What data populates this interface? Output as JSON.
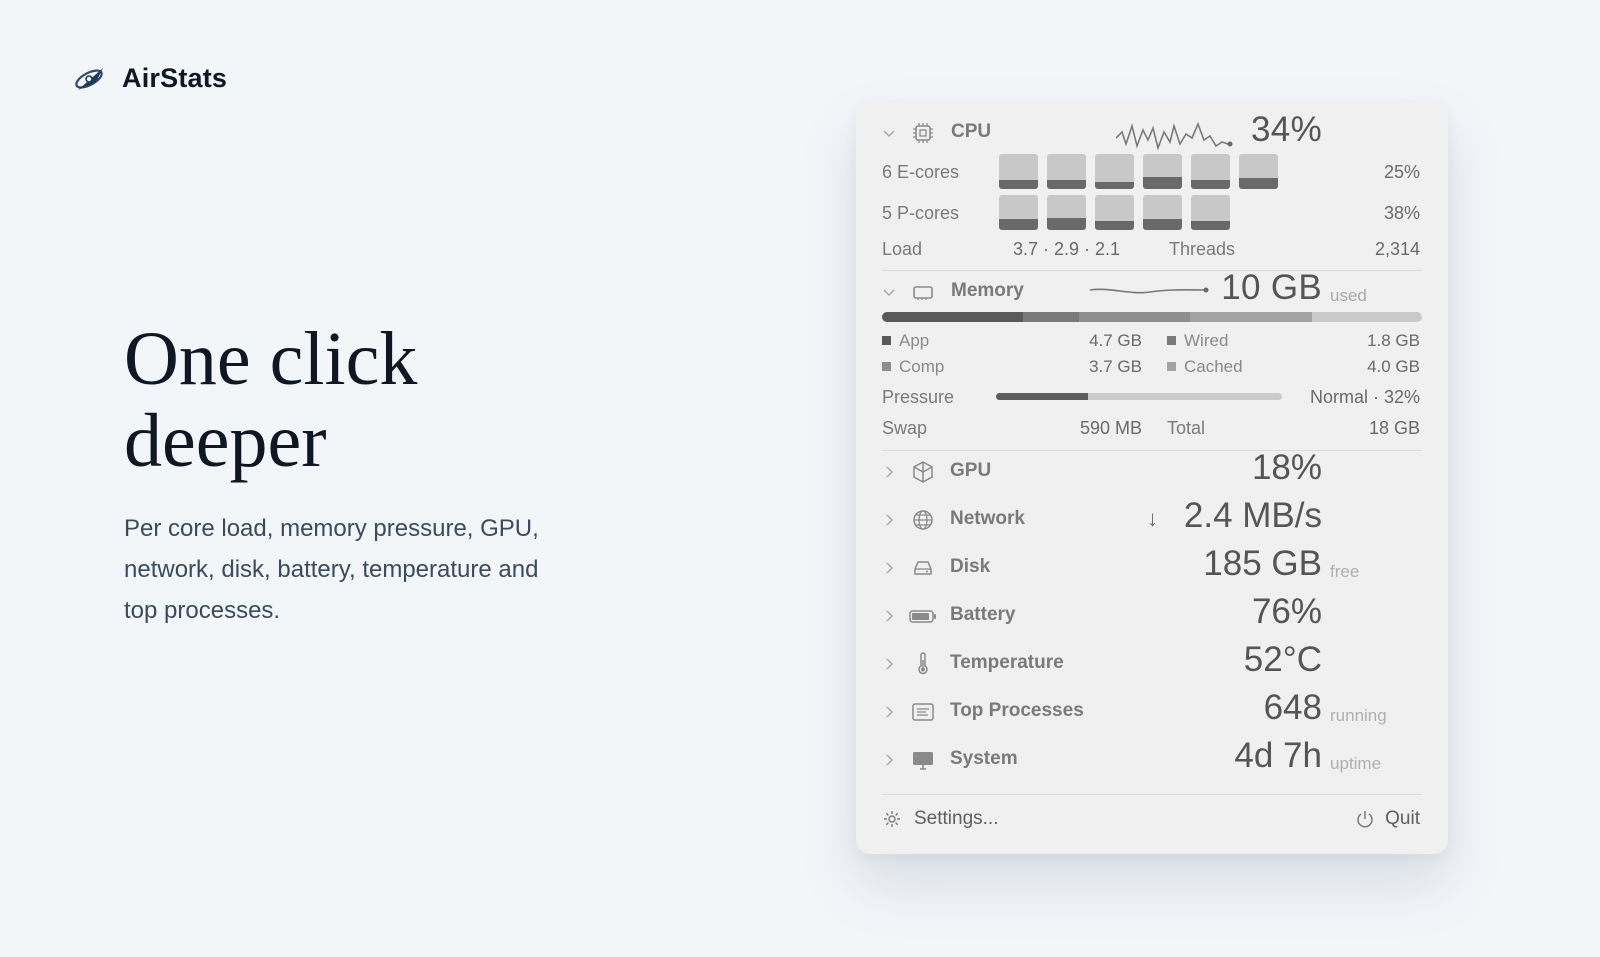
{
  "brand": {
    "name": "AirStats"
  },
  "hero": {
    "headline_line1": "One click",
    "headline_line2": "deeper",
    "subtitle": "Per core load, memory pressure, GPU, network, disk, battery, temperature and top processes."
  },
  "panel": {
    "cpu": {
      "label": "CPU",
      "value": "34%",
      "ecores_label": "6 E-cores",
      "ecores_pct": "25%",
      "ecore_loads": [
        0.25,
        0.25,
        0.2,
        0.35,
        0.25,
        0.3
      ],
      "pcores_label": "5 P-cores",
      "pcores_pct": "38%",
      "pcore_loads": [
        0.3,
        0.35,
        0.25,
        0.3,
        0.25
      ],
      "load_label": "Load",
      "load_value": "3.7 · 2.9 · 2.1",
      "threads_label": "Threads",
      "threads_value": "2,314"
    },
    "memory": {
      "label": "Memory",
      "value": "10 GB",
      "unit": "used",
      "app_label": "App",
      "app_value": "4.7 GB",
      "wired_label": "Wired",
      "wired_value": "1.8 GB",
      "comp_label": "Comp",
      "comp_value": "3.7 GB",
      "cached_label": "Cached",
      "cached_value": "4.0 GB",
      "pressure_label": "Pressure",
      "pressure_value": "Normal · 32%",
      "pressure_level": 0.32,
      "swap_label": "Swap",
      "swap_value": "590 MB",
      "total_label": "Total",
      "total_value": "18 GB"
    },
    "rows": {
      "gpu": {
        "label": "GPU",
        "value": "18%"
      },
      "network": {
        "label": "Network",
        "arrow": "↓",
        "value": "2.4 MB/s"
      },
      "disk": {
        "label": "Disk",
        "value": "185 GB",
        "unit": "free"
      },
      "battery": {
        "label": "Battery",
        "value": "76%"
      },
      "temperature": {
        "label": "Temperature",
        "value": "52°C"
      },
      "processes": {
        "label": "Top Processes",
        "value": "648",
        "unit": "running"
      },
      "system": {
        "label": "System",
        "value": "4d 7h",
        "unit": "uptime"
      }
    },
    "footer": {
      "settings_label": "Settings...",
      "quit_label": "Quit"
    }
  },
  "colors": {
    "background": "#f3f6f9",
    "panel": "#f0f0f0",
    "headline": "#0f1723",
    "subtitle": "#3b4a5d",
    "brand_accent": "#1f3c5a"
  }
}
